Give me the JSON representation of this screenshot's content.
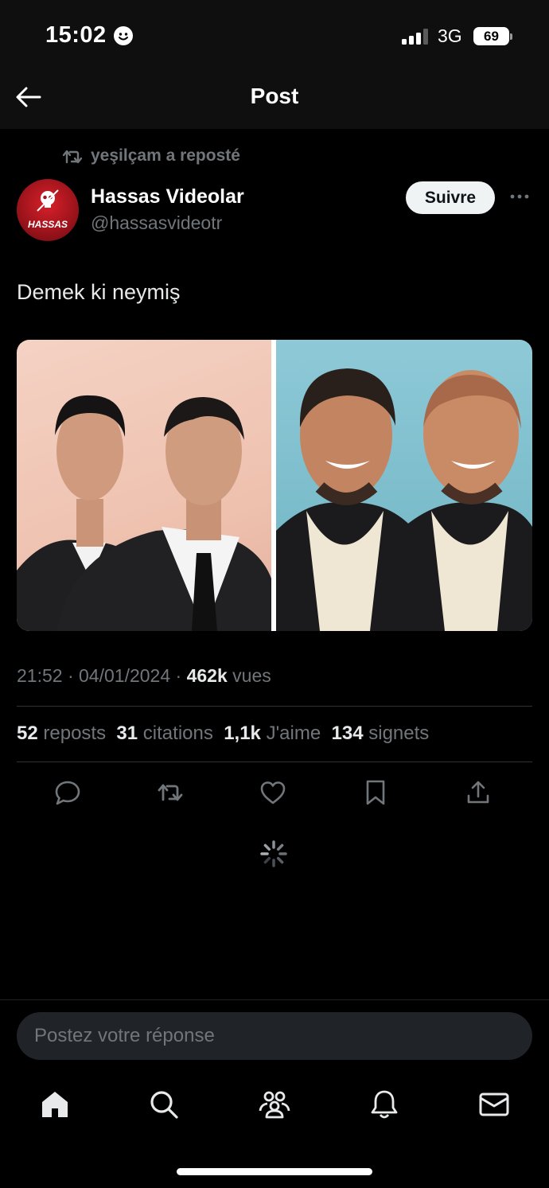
{
  "status_bar": {
    "time": "15:02",
    "network": "3G",
    "battery": "69"
  },
  "header": {
    "title": "Post"
  },
  "repost_line": {
    "text": "yeşilçam a reposté"
  },
  "author": {
    "name": "Hassas Videolar",
    "handle": "@hassasvideotr",
    "avatar_text": "HASSAS"
  },
  "follow_button": {
    "label": "Suivre"
  },
  "post": {
    "text": "Demek ki neymiş"
  },
  "meta": {
    "time": "21:52",
    "date": "04/01/2024",
    "views_count": "462k",
    "views_label": "vues"
  },
  "stats": {
    "reposts_count": "52",
    "reposts_label": "reposts",
    "quotes_count": "31",
    "quotes_label": "citations",
    "likes_count": "1,1k",
    "likes_label": "J'aime",
    "bookmarks_count": "134",
    "bookmarks_label": "signets"
  },
  "reply": {
    "placeholder": "Postez votre réponse"
  },
  "icons": {
    "back": "arrow-left-icon",
    "repost": "repost-icon",
    "more": "more-dots-icon",
    "reply": "reply-icon",
    "retweet": "retweet-icon",
    "like": "heart-icon",
    "bookmark": "bookmark-icon",
    "share": "share-icon",
    "loading": "spinner-icon",
    "home": "home-icon",
    "search": "search-icon",
    "communities": "communities-icon",
    "notifications": "bell-icon",
    "messages": "mail-icon"
  },
  "colors": {
    "background": "#000000",
    "text": "#e7e9ea",
    "muted": "#71767b",
    "divider": "#2f3336",
    "follow_bg": "#eff3f4"
  }
}
